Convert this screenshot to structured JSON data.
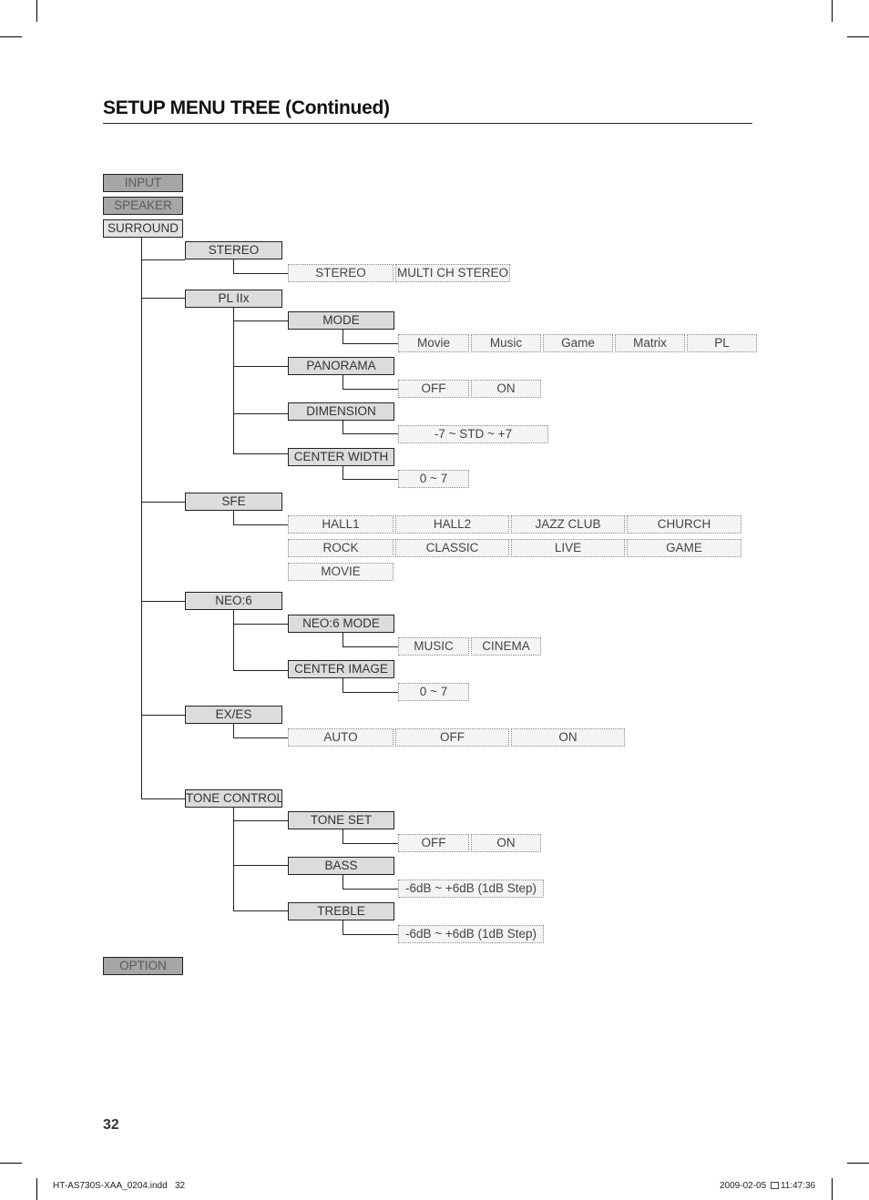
{
  "page": {
    "title": "SETUP MENU TREE (Continued)",
    "page_number": "32",
    "footer_file": "HT-AS730S-XAA_0204.indd   32",
    "footer_date": "2009-02-05",
    "footer_time": "11:47:36"
  },
  "menu": {
    "top": [
      {
        "label": "INPUT",
        "state": "inactive"
      },
      {
        "label": "SPEAKER",
        "state": "inactive"
      },
      {
        "label": "SURROUND",
        "state": "active"
      }
    ],
    "option": {
      "label": "OPTION",
      "state": "inactive"
    },
    "surround": {
      "stereo": {
        "label": "STEREO",
        "options": [
          "STEREO",
          "MULTI CH STEREO"
        ]
      },
      "plllx": {
        "label": "PL IIx",
        "mode": {
          "label": "MODE",
          "options": [
            "Movie",
            "Music",
            "Game",
            "Matrix",
            "PL"
          ]
        },
        "panorama": {
          "label": "PANORAMA",
          "options": [
            "OFF",
            "ON"
          ]
        },
        "dimension": {
          "label": "DIMENSION",
          "options": [
            "-7 ~ STD ~ +7"
          ]
        },
        "center_width": {
          "label": "CENTER WIDTH",
          "options": [
            "0 ~ 7"
          ]
        }
      },
      "sfe": {
        "label": "SFE",
        "options": [
          "HALL1",
          "HALL2",
          "JAZZ CLUB",
          "CHURCH",
          "ROCK",
          "CLASSIC",
          "LIVE",
          "GAME",
          "MOVIE"
        ]
      },
      "neo6": {
        "label": "NEO:6",
        "mode": {
          "label": "NEO:6 MODE",
          "options": [
            "MUSIC",
            "CINEMA"
          ]
        },
        "center_image": {
          "label": "CENTER IMAGE",
          "options": [
            "0 ~ 7"
          ]
        }
      },
      "exes": {
        "label": "EX/ES",
        "options": [
          "AUTO",
          "OFF",
          "ON"
        ]
      },
      "tone": {
        "label": "TONE CONTROL",
        "tone_set": {
          "label": "TONE SET",
          "options": [
            "OFF",
            "ON"
          ]
        },
        "bass": {
          "label": "BASS",
          "options": [
            "-6dB ~ +6dB (1dB Step)"
          ]
        },
        "treble": {
          "label": "TREBLE",
          "options": [
            "-6dB ~ +6dB (1dB Step)"
          ]
        }
      }
    }
  }
}
